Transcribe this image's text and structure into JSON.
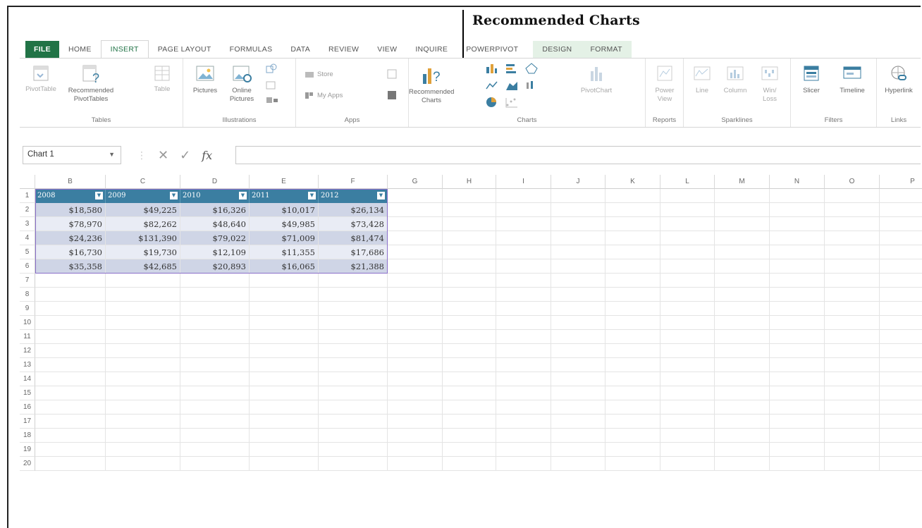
{
  "annotation": {
    "title": "Recommended Charts"
  },
  "tabs": [
    {
      "label": "FILE",
      "kind": "file"
    },
    {
      "label": "HOME",
      "kind": "normal"
    },
    {
      "label": "INSERT",
      "kind": "active"
    },
    {
      "label": "PAGE LAYOUT",
      "kind": "normal"
    },
    {
      "label": "FORMULAS",
      "kind": "normal"
    },
    {
      "label": "DATA",
      "kind": "normal"
    },
    {
      "label": "REVIEW",
      "kind": "normal"
    },
    {
      "label": "VIEW",
      "kind": "normal"
    },
    {
      "label": "INQUIRE",
      "kind": "normal"
    },
    {
      "label": "POWERPIVOT",
      "kind": "normal"
    }
  ],
  "context_tabs": [
    "DESIGN",
    "FORMAT"
  ],
  "ribbon": {
    "tables": {
      "label": "Tables",
      "pivottable": "PivotTable",
      "recommended_pivot_l1": "Recommended",
      "recommended_pivot_l2": "PivotTables",
      "table": "Table"
    },
    "illustrations": {
      "label": "Illustrations",
      "pictures": "Pictures",
      "online_l1": "Online",
      "online_l2": "Pictures"
    },
    "apps": {
      "label": "Apps",
      "store": "Store",
      "myapps": "My Apps"
    },
    "charts": {
      "label": "Charts",
      "recommended_l1": "Recommended",
      "recommended_l2": "Charts",
      "pivotchart": "PivotChart"
    },
    "reports": {
      "label": "Reports",
      "power_l1": "Power",
      "power_l2": "View"
    },
    "sparklines": {
      "label": "Sparklines",
      "line": "Line",
      "column": "Column",
      "winloss_l1": "Win/",
      "winloss_l2": "Loss"
    },
    "filters": {
      "label": "Filters",
      "slicer": "Slicer",
      "timeline": "Timeline"
    },
    "links": {
      "label": "Links",
      "hyperlink": "Hyperlink"
    }
  },
  "formula_bar": {
    "name_box": "Chart 1",
    "fx": "fx",
    "cancel": "✕",
    "enter": "✓",
    "formula": ""
  },
  "columns": [
    "B",
    "C",
    "D",
    "E",
    "F",
    "G",
    "H",
    "I",
    "J",
    "K",
    "L",
    "M",
    "N",
    "O",
    "P"
  ],
  "rows": [
    "1",
    "2",
    "3",
    "4",
    "5",
    "6",
    "7",
    "8",
    "9",
    "10",
    "11",
    "12",
    "13",
    "14",
    "15",
    "16",
    "17",
    "18",
    "19",
    "20"
  ],
  "table": {
    "headers": [
      "2008",
      "2009",
      "2010",
      "2011",
      "2012"
    ],
    "data": [
      [
        "$18,580",
        "$49,225",
        "$16,326",
        "$10,017",
        "$26,134"
      ],
      [
        "$78,970",
        "$82,262",
        "$48,640",
        "$49,985",
        "$73,428"
      ],
      [
        "$24,236",
        "$131,390",
        "$79,022",
        "$71,009",
        "$81,474"
      ],
      [
        "$16,730",
        "$19,730",
        "$12,109",
        "$11,355",
        "$17,686"
      ],
      [
        "$35,358",
        "$42,685",
        "$20,893",
        "$16,065",
        "$21,388"
      ]
    ]
  },
  "colors": {
    "excel_green": "#217346",
    "table_header": "#3b7ea1",
    "band_dark": "#cfd5e6",
    "band_light": "#e9ecf5",
    "context_tab": "#e4f1e6"
  }
}
